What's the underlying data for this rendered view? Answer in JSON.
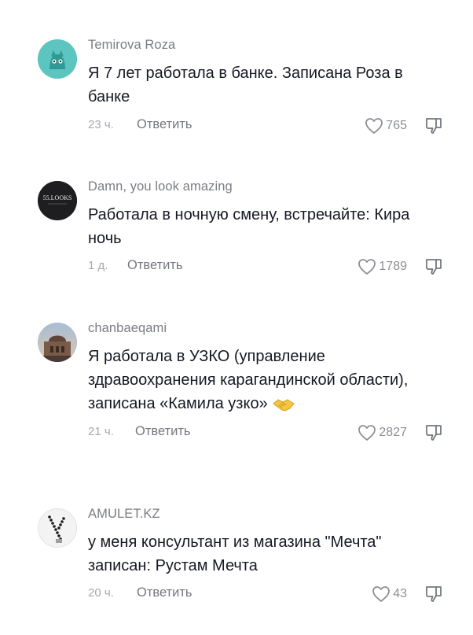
{
  "comments": [
    {
      "username": "Temirova Roza",
      "text": "Я 7 лет работала в банке. Записана Роза в банке",
      "time": "23 ч.",
      "reply_label": "Ответить",
      "likes": "765",
      "avatar": "cat-face-teal"
    },
    {
      "username": "Damn, you look amazing",
      "text": "Работала в ночную смену, встречайте: Кира ночь",
      "time": "1 д.",
      "reply_label": "Ответить",
      "likes": "1789",
      "avatar": "55-looks-logo-dark",
      "avatar_logo": "55.LOOKS"
    },
    {
      "username": "chanbaeqami",
      "text": "Я работала в УЗКО (управление здравоохранения карагандинской области), записана «Камила узко»",
      "emoji": "handshake",
      "time": "21 ч.",
      "reply_label": "Ответить",
      "likes": "2827",
      "avatar": "photo-building"
    },
    {
      "username": "AMULET.KZ",
      "text": "у меня консультант из магазина \"Мечта\" записан: Рустам Мечта",
      "time": "20 ч.",
      "reply_label": "Ответить",
      "likes": "43",
      "avatar": "bead-necklace"
    }
  ],
  "colors": {
    "text": "#161823",
    "username": "#7b7d85",
    "meta": "#a7a8ad",
    "avatar_teal": "#5cc5c0"
  }
}
